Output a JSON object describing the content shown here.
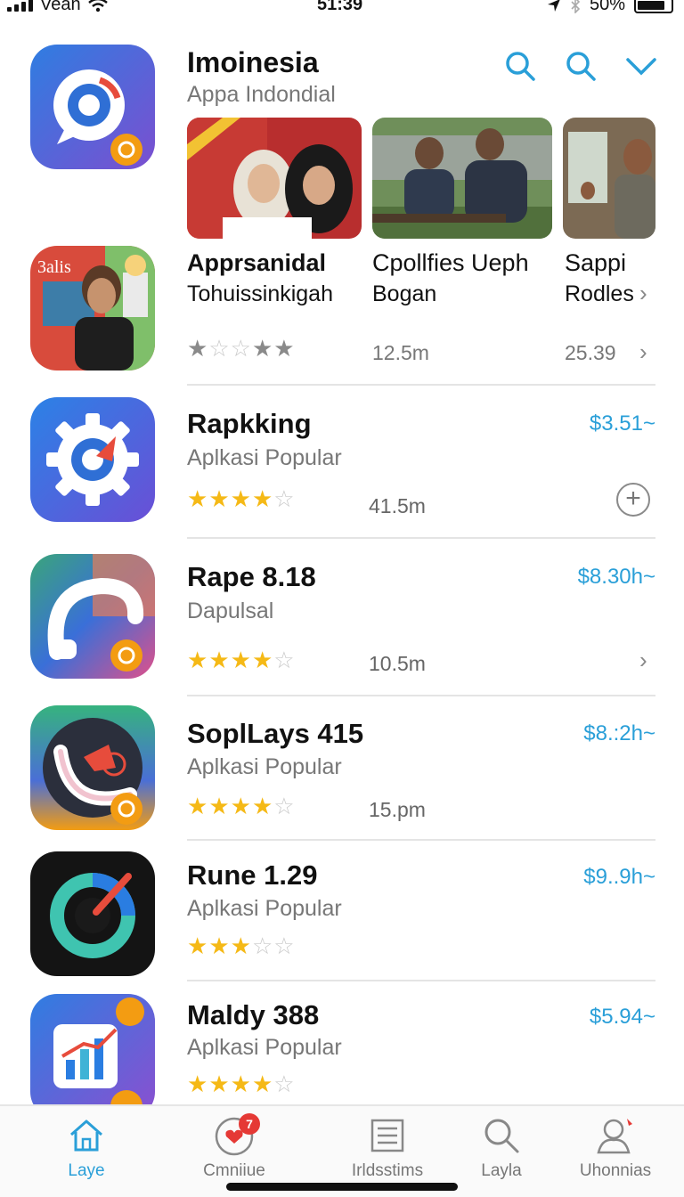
{
  "status_bar": {
    "carrier": "Vean",
    "time": "51:39",
    "battery": "50%"
  },
  "header": {
    "title": "Imoinesia",
    "subtitle": "Appa Indondial"
  },
  "featured": [
    {
      "title": "Apprsanidal",
      "subtitle": "Tohuissinkigah",
      "rating": 1,
      "size": "12.5m"
    },
    {
      "title": "Cpollfies Ueph",
      "subtitle": "Bogan"
    },
    {
      "title": "Sappi",
      "subtitle": "Rodles",
      "size": "25.39"
    }
  ],
  "poster_text": "3alis",
  "apps": [
    {
      "title": "Rapkking",
      "subtitle": "Aplkasi Popular",
      "price": "$3.51~",
      "size": "41.5m",
      "rating": 4
    },
    {
      "title": "Rape 8.18",
      "subtitle": "Dapulsal",
      "price": "$8.30h~",
      "size": "10.5m",
      "rating": 4
    },
    {
      "title": "SoplLays 415",
      "subtitle": "Aplkasi Popular",
      "price": "$8.:2h~",
      "size": "15.pm",
      "rating": 3.5
    },
    {
      "title": "Rune 1.29",
      "subtitle": "Aplkasi Popular",
      "price": "$9..9h~",
      "rating": 3
    },
    {
      "title": "Maldy 388",
      "subtitle": "Aplkasi Popular",
      "price": "$5.94~",
      "rating": 4
    }
  ],
  "tabs": [
    {
      "label": "Laye",
      "active": true
    },
    {
      "label": "Cmniiue",
      "badge": "7"
    },
    {
      "label": "Irldsstims"
    },
    {
      "label": "Layla"
    },
    {
      "label": "Uhonnias"
    }
  ],
  "colors": {
    "accent": "#2a9fd8",
    "star": "#f5b916",
    "badge": "#e53935"
  }
}
